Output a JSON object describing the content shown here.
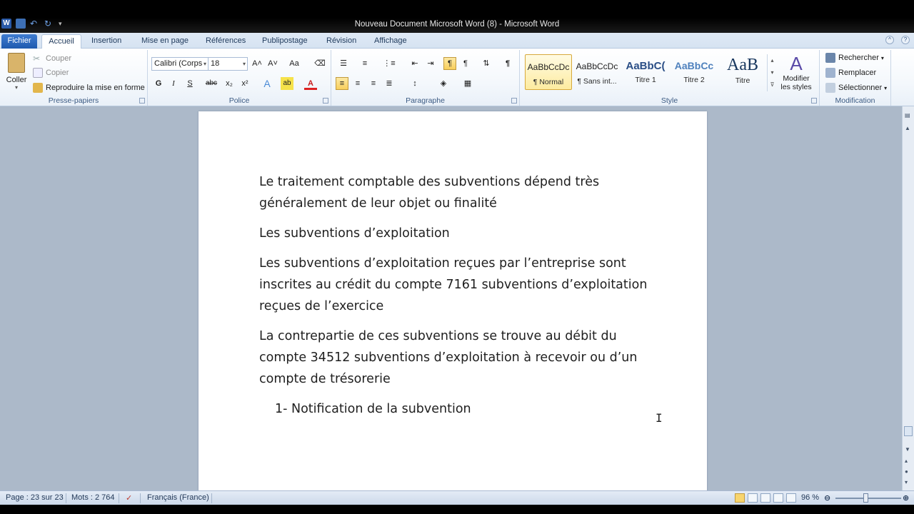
{
  "window": {
    "title": "Nouveau Document Microsoft Word (8)  -  Microsoft Word"
  },
  "tabs": {
    "file": "Fichier",
    "items": [
      "Accueil",
      "Insertion",
      "Mise en page",
      "Références",
      "Publipostage",
      "Révision",
      "Affichage"
    ]
  },
  "ribbon": {
    "clipboard": {
      "paste": "Coller",
      "cut": "Couper",
      "copy": "Copier",
      "format_painter": "Reproduire la mise en forme",
      "label": "Presse-papiers"
    },
    "font": {
      "font_name": "Calibri (Corps",
      "font_size": "18",
      "label": "Police",
      "bold": "G",
      "italic": "I",
      "underline": "S",
      "strike": "abc",
      "subscript": "x₂",
      "superscript": "x²"
    },
    "paragraph": {
      "label": "Paragraphe"
    },
    "styles": {
      "label": "Style",
      "items": [
        {
          "sample": "AaBbCcDc",
          "name": "¶ Normal"
        },
        {
          "sample": "AaBbCcDc",
          "name": "¶ Sans int..."
        },
        {
          "sample": "AaBbC(",
          "name": "Titre 1"
        },
        {
          "sample": "AaBbCc",
          "name": "Titre 2"
        },
        {
          "sample": "AaB",
          "name": "Titre"
        }
      ],
      "change_styles": "Modifier les styles"
    },
    "editing": {
      "label": "Modification",
      "find": "Rechercher",
      "replace": "Remplacer",
      "select": "Sélectionner"
    }
  },
  "document": {
    "paragraphs": [
      "Le traitement comptable des subventions dépend très généralement de leur objet ou finalité",
      "Les subventions d’exploitation",
      "Les subventions d’exploitation reçues par l’entreprise sont inscrites au crédit du compte 7161 subventions d’exploitation reçues de l’exercice",
      "La contrepartie de ces subventions se trouve au débit du compte 34512 subventions d’exploitation à recevoir ou d’un compte de trésorerie",
      "1- Notification de la subvention"
    ]
  },
  "statusbar": {
    "page": "Page : 23 sur 23",
    "words": "Mots : 2 764",
    "language": "Français (France)",
    "zoom": "96 %"
  },
  "colors": {
    "file_tab": "#2a62b7",
    "selected_style": "#fdeba0",
    "workspace": "#acb9c9"
  }
}
